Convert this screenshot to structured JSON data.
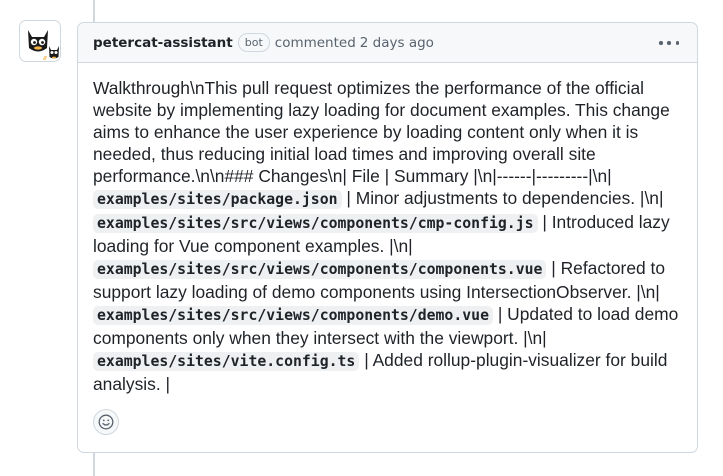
{
  "comment": {
    "author": "petercat-assistant",
    "badge": "bot",
    "action": "commented",
    "time": "2 days ago",
    "body": [
      {
        "type": "text",
        "text": "Walkthrough\\nThis pull request optimizes the performance of the official website by implementing lazy loading for document examples. This change aims to enhance the user experience by loading content only when it is needed, thus reducing initial load times and improving overall site performance.\\n\\n### Changes\\n| File | Summary |\\n|------|---------|\\n| "
      },
      {
        "type": "code",
        "text": "examples/sites/package.json"
      },
      {
        "type": "text",
        "text": " | Minor adjustments to dependencies. |\\n| "
      },
      {
        "type": "code",
        "text": "examples/sites/src/views/components/cmp-config.js"
      },
      {
        "type": "text",
        "text": " | Introduced lazy loading for Vue component examples. |\\n| "
      },
      {
        "type": "code",
        "text": "examples/sites/src/views/components/components.vue"
      },
      {
        "type": "text",
        "text": " | Refactored to support lazy loading of demo components using IntersectionObserver. |\\n| "
      },
      {
        "type": "code",
        "text": "examples/sites/src/views/components/demo.vue"
      },
      {
        "type": "text",
        "text": " | Updated to load demo components only when they intersect with the viewport. |\\n| "
      },
      {
        "type": "code",
        "text": "examples/sites/vite.config.ts"
      },
      {
        "type": "text",
        "text": " | Added rollup-plugin-visualizer for build analysis. |"
      }
    ]
  },
  "icons": {
    "avatar": "black-cat-avatar",
    "menu": "kebab-horizontal-icon",
    "reaction": "smiley-icon"
  },
  "colors": {
    "border": "#d0d7de",
    "header_bg": "#f6f8fa",
    "muted_text": "#59636e",
    "code_bg": "#eef0f2"
  }
}
